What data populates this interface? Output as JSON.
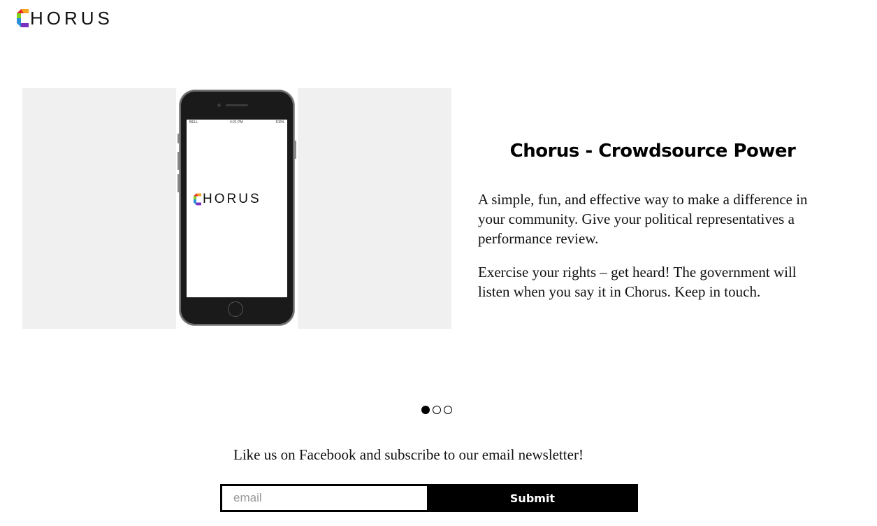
{
  "header": {
    "logo_text": "HORUS"
  },
  "hero": {
    "phone_status": {
      "carrier": "BELL",
      "time": "4:21 PM",
      "battery": "100%"
    },
    "phone_logo_text": "HORUS",
    "title": "Chorus - Crowdsource Power",
    "paragraph_1": "A simple, fun, and effective way to make a difference in your community. Give your political representatives a performance review.",
    "paragraph_2": "Exercise your rights – get heard! The government will listen when you say it in Chorus. Keep in touch."
  },
  "carousel": {
    "slide_count": 3,
    "active_index": 0
  },
  "newsletter": {
    "prompt": "Like us on Facebook and subscribe to our email newsletter!",
    "email_placeholder": "email",
    "email_value": "",
    "submit_label": "Submit"
  },
  "colors": {
    "logo_mark": [
      "#e8292b",
      "#f5a623",
      "#7ed321",
      "#2a8fd8",
      "#7b2fbe"
    ],
    "button_bg": "#000000",
    "image_bg": "#f0f0f0"
  }
}
